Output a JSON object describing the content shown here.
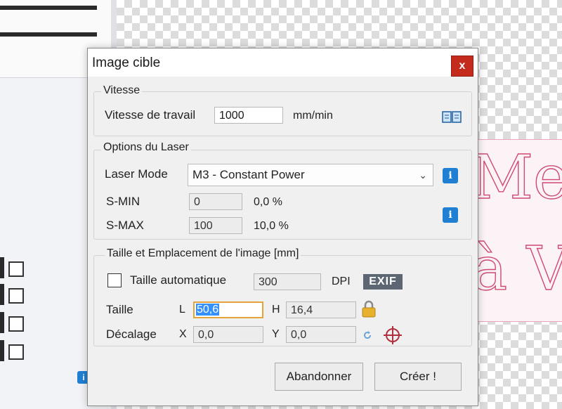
{
  "dialog": {
    "title": "Image cible",
    "close_label": "x",
    "speed_group": {
      "label": "Vitesse",
      "work_speed_label": "Vitesse de travail",
      "work_speed_value": "1000",
      "unit": "mm/min"
    },
    "laser_group": {
      "label": "Options du Laser",
      "mode_label": "Laser Mode",
      "mode_value": "M3 - Constant Power",
      "smin_label": "S-MIN",
      "smin_value": "0",
      "smin_percent": "0,0 %",
      "smax_label": "S-MAX",
      "smax_value": "100",
      "smax_percent": "10,0 %"
    },
    "size_group": {
      "label": "Taille et Emplacement de l'image [mm]",
      "auto_size_label": "Taille automatique",
      "dpi_value": "300",
      "dpi_label": "DPI",
      "exif_label": "EXIF",
      "size_label": "Taille",
      "l_label": "L",
      "l_value": "50,6",
      "h_label": "H",
      "h_value": "16,4",
      "offset_label": "Décalage",
      "x_label": "X",
      "x_value": "0,0",
      "y_label": "Y",
      "y_value": "0,0"
    },
    "buttons": {
      "cancel": "Abandonner",
      "create": "Créer !"
    }
  },
  "background": {
    "preview_line1": "Me",
    "preview_line2": "à V",
    "info_glyph": "i"
  },
  "colors": {
    "close_button": "#c42b1c",
    "info_button": "#1f7fd2",
    "exif_badge": "#5d6774",
    "preview_stroke": "#d04a72"
  }
}
